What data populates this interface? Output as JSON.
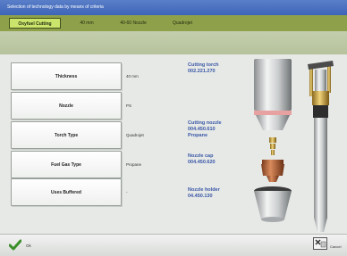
{
  "window": {
    "title": "Selection of technology data by means of criteria"
  },
  "tabs": [
    {
      "label": "Oxyfuel Cutting"
    },
    {
      "label": "40 mm"
    },
    {
      "label": "40-60 Nozzle"
    },
    {
      "label": "Quadrojet"
    }
  ],
  "criteria": [
    {
      "label": "Thickness",
      "value": "40 mm"
    },
    {
      "label": "Nozzle",
      "value": "PS"
    },
    {
      "label": "Torch Type",
      "value": "Quadrojet"
    },
    {
      "label": "Fuel Gas Type",
      "value": "Propane"
    },
    {
      "label": "Uses Buffered",
      "value": "-"
    }
  ],
  "parts": {
    "torch": {
      "title": "Cutting torch",
      "code": "002.221.270"
    },
    "nozzle": {
      "title": "Cutting nozzle",
      "code": "004.450.610",
      "sub": "Propane"
    },
    "cap": {
      "title": "Nozzle cap",
      "code": "004.450.620"
    },
    "holder": {
      "title": "Nozzle holder",
      "code": "04.450.130"
    }
  },
  "footer": {
    "ok_label": "Ok",
    "cancel_label": "Cancel"
  },
  "colors": {
    "tab_bar": "#8fa04a",
    "active_tab": "#cbe46c",
    "label_blue": "#3956a7",
    "title_bar": "#4a70c0"
  }
}
